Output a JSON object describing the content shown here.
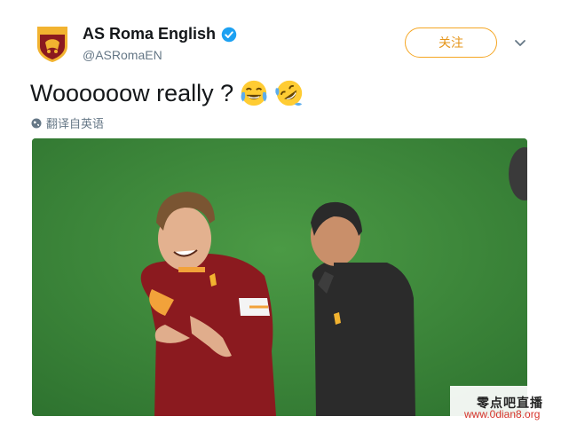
{
  "account": {
    "display_name": "AS Roma English",
    "handle": "@ASRomaEN",
    "verified": true,
    "avatar_icon": "as-roma-crest-icon"
  },
  "actions": {
    "follow_label": "关注",
    "menu_icon": "chevron-down-icon"
  },
  "tweet": {
    "text": "Woooooow really ?",
    "emojis": [
      "face-with-tears-of-joy",
      "rolling-on-the-floor-laughing"
    ],
    "translate_label": "翻译自英语"
  },
  "media": {
    "type": "video-still",
    "description_icon": "football-players-photo"
  },
  "watermark": {
    "line1": "零点吧直播",
    "line2": "www.0dian8.org"
  },
  "colors": {
    "accent": "#f5a623",
    "verified_blue": "#1da1f2",
    "secondary_text": "#657786",
    "pitch_green": "#3f8a3a",
    "roma_maroon": "#8b1a1f"
  }
}
